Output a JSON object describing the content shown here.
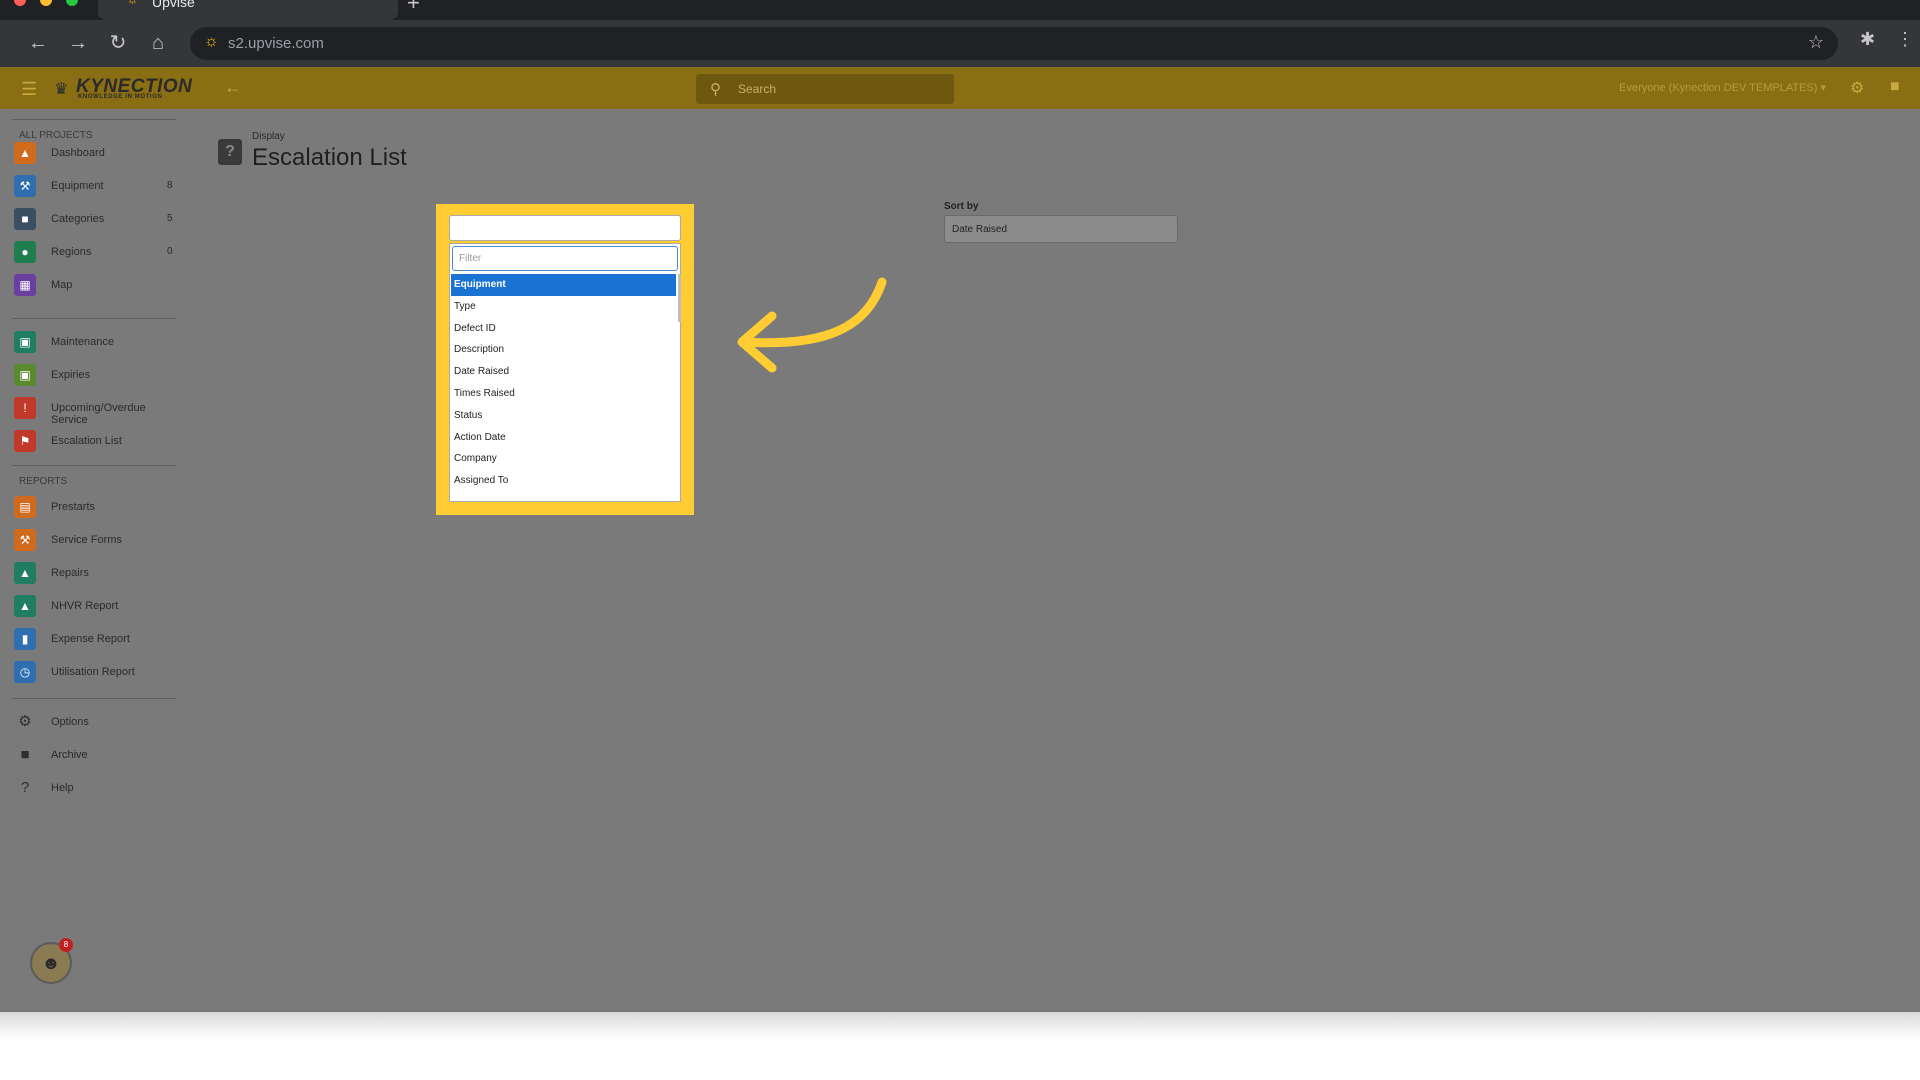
{
  "browser": {
    "tab_title": "Upvise",
    "url": "s2.upvise.com"
  },
  "appbar": {
    "logo_main": "KYNECTION",
    "logo_sub": "KNOWLEDGE IN MOTION",
    "search_placeholder": "Search",
    "context": "Everyone (Kynection DEV TEMPLATES) ▾"
  },
  "sidebar": {
    "section_all": "ALL PROJECTS",
    "section_reports": "REPORTS",
    "items_main": [
      {
        "label": "Dashboard",
        "count": "",
        "icon": "chart-icon",
        "color": "#d06b1e"
      },
      {
        "label": "Equipment",
        "count": "8",
        "icon": "wrench-icon",
        "color": "#2f6fb0"
      },
      {
        "label": "Categories",
        "count": "5",
        "icon": "folder-icon",
        "color": "#3b4f63"
      },
      {
        "label": "Regions",
        "count": "0",
        "icon": "pin-icon",
        "color": "#1f7d4f"
      },
      {
        "label": "Map",
        "count": "",
        "icon": "map-icon",
        "color": "#6b3fa0"
      }
    ],
    "items_schedule": [
      {
        "label": "Maintenance",
        "icon": "calendar-icon",
        "color": "#1f7d62"
      },
      {
        "label": "Expiries",
        "icon": "calendar-icon",
        "color": "#5a8a2e"
      },
      {
        "label": "Upcoming/Overdue Service",
        "icon": "alert-doc-icon",
        "color": "#c0392b"
      },
      {
        "label": "Escalation List",
        "icon": "flag-icon",
        "color": "#c0392b"
      }
    ],
    "items_reports": [
      {
        "label": "Prestarts",
        "icon": "doc-icon",
        "color": "#d06b1e"
      },
      {
        "label": "Service Forms",
        "icon": "wrench-icon",
        "color": "#d06b1e"
      },
      {
        "label": "Repairs",
        "icon": "chart-icon",
        "color": "#1f7d62"
      },
      {
        "label": "NHVR Report",
        "icon": "chart-icon",
        "color": "#1f7d62"
      },
      {
        "label": "Expense Report",
        "icon": "bars-icon",
        "color": "#2f6fb0"
      },
      {
        "label": "Utilisation Report",
        "icon": "clock-icon",
        "color": "#2f6fb0"
      }
    ],
    "items_footer": [
      {
        "label": "Options",
        "icon": "gear-icon"
      },
      {
        "label": "Archive",
        "icon": "archive-icon"
      },
      {
        "label": "Help",
        "icon": "help-icon"
      }
    ],
    "notification_count": "8"
  },
  "main": {
    "breadcrumb": "Display",
    "title": "Escalation List",
    "sort_by": {
      "label": "Sort by",
      "value": "Date Raised"
    },
    "group_by": {
      "filter_placeholder": "Filter",
      "options": [
        "Equipment",
        "Type",
        "Defect ID",
        "Description",
        "Date Raised",
        "Times Raised",
        "Status",
        "Action Date",
        "Company",
        "Assigned To"
      ],
      "selected": "Equipment"
    }
  },
  "colors": {
    "highlight": "#ffcc33",
    "appbar": "#8a6e14",
    "selected_option": "#1a73d2"
  }
}
